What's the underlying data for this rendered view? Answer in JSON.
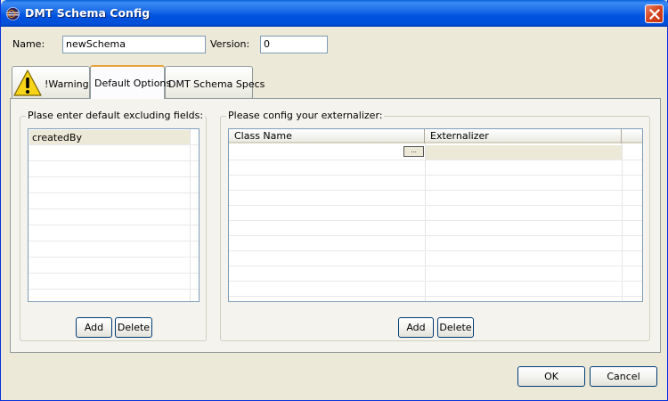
{
  "window": {
    "title": "DMT Schema Config"
  },
  "fields": {
    "name_label": "Name:",
    "name_value": "newSchema",
    "version_label": "Version:",
    "version_value": "0"
  },
  "tabs": [
    {
      "label": "!Warning!",
      "icon": "warning-icon"
    },
    {
      "label": "Default Options",
      "active": true
    },
    {
      "label": "DMT Schema Specs"
    }
  ],
  "excluding": {
    "title": "Plase enter default excluding fields:",
    "items": [
      "createdBy"
    ],
    "add_label": "Add",
    "delete_label": "Delete"
  },
  "externalizer": {
    "title": "Please config your externalizer:",
    "columns": [
      "Class Name",
      "Externalizer"
    ],
    "cell_button_label": "...",
    "add_label": "Add",
    "delete_label": "Delete"
  },
  "footer": {
    "ok_label": "OK",
    "cancel_label": "Cancel"
  },
  "colors": {
    "titlebar": "#0053e0",
    "selection": "#ece9d8",
    "tab_highlight": "#e8a33c"
  }
}
